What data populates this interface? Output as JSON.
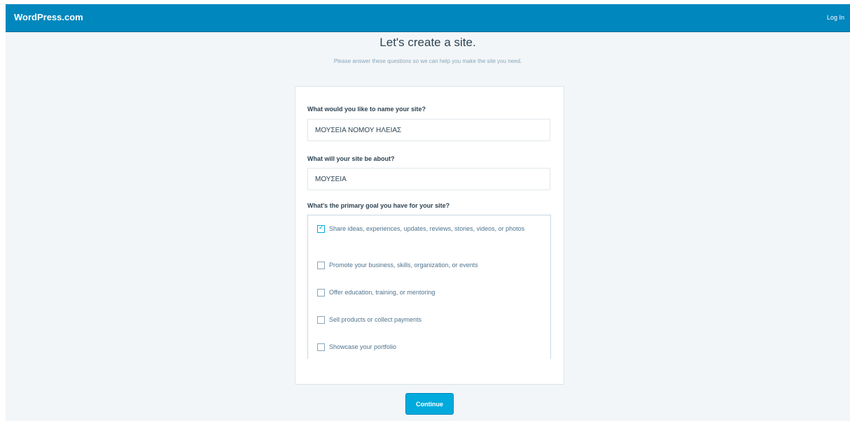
{
  "masterbar": {
    "brand": "WordPress.com",
    "login": "Log In"
  },
  "header": {
    "title": "Let's create a site.",
    "subtitle": "Please answer these questions so we can help you make the site you need."
  },
  "form": {
    "site_name": {
      "label": "What would you like to name your site?",
      "value": "ΜΟΥΣΕΙΑ ΝΟΜΟΥ ΗΛΕΙΑΣ"
    },
    "site_topic": {
      "label": "What will your site be about?",
      "value": "ΜΟΥΣΕΙΑ"
    },
    "goals": {
      "label": "What's the primary goal you have for your site?",
      "options": [
        {
          "text": "Share ideas, experiences, updates, reviews, stories, videos, or photos",
          "checked": true
        },
        {
          "text": "Promote your business, skills, organization, or events",
          "checked": false
        },
        {
          "text": "Offer education, training, or mentoring",
          "checked": false
        },
        {
          "text": "Sell products or collect payments",
          "checked": false
        },
        {
          "text": "Showcase your portfolio",
          "checked": false
        }
      ]
    }
  },
  "actions": {
    "continue": "Continue"
  },
  "colors": {
    "masterbar": "#0087be",
    "background": "#f3f6f8",
    "accent": "#00aadc"
  }
}
